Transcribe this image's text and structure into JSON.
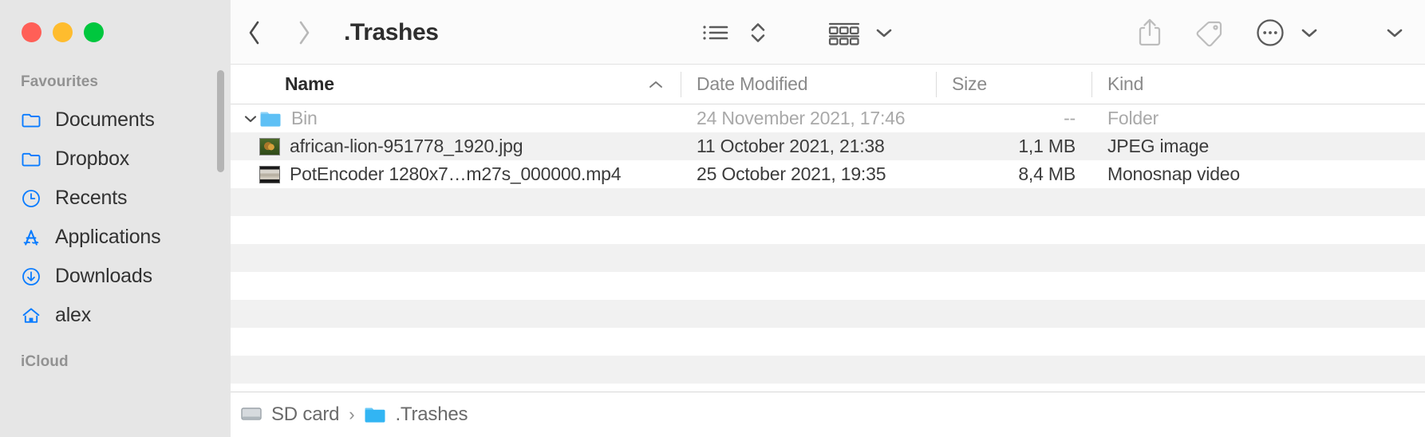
{
  "window": {
    "title": ".Trashes",
    "traffic_lights": [
      {
        "name": "close",
        "color": "#ff5f57"
      },
      {
        "name": "minimize",
        "color": "#febc2e"
      },
      {
        "name": "maximize",
        "color": "#00c73e"
      }
    ]
  },
  "sidebar": {
    "sections": [
      {
        "label": "Favourites"
      },
      {
        "label": "iCloud"
      }
    ],
    "items": [
      {
        "label": "Documents",
        "icon": "folder-icon"
      },
      {
        "label": "Dropbox",
        "icon": "folder-icon"
      },
      {
        "label": "Recents",
        "icon": "clock-icon"
      },
      {
        "label": "Applications",
        "icon": "applications-icon"
      },
      {
        "label": "Downloads",
        "icon": "download-circle-icon"
      },
      {
        "label": "alex",
        "icon": "home-icon"
      }
    ],
    "accent_color": "#0a7cff"
  },
  "toolbar": {
    "back": "back-chevron",
    "forward": "forward-chevron",
    "buttons": [
      {
        "name": "view-as-list",
        "icon": "list-view-icon"
      },
      {
        "name": "view-stepper",
        "icon": "up-down-chevron-icon"
      },
      {
        "name": "group-by",
        "icon": "group-items-icon"
      },
      {
        "name": "group-by-menu",
        "icon": "chevron-down-icon"
      },
      {
        "name": "share",
        "icon": "share-icon"
      },
      {
        "name": "tags",
        "icon": "tag-icon"
      },
      {
        "name": "more-actions",
        "icon": "ellipsis-circle-icon"
      },
      {
        "name": "more-menu",
        "icon": "chevron-down-icon"
      },
      {
        "name": "overflow-menu",
        "icon": "chevron-down-icon"
      },
      {
        "name": "search",
        "icon": "search-icon"
      }
    ]
  },
  "columns": [
    {
      "key": "name",
      "label": "Name",
      "sorted": true,
      "sort_direction": "ascending"
    },
    {
      "key": "date",
      "label": "Date Modified",
      "sorted": false
    },
    {
      "key": "size",
      "label": "Size",
      "sorted": false
    },
    {
      "key": "kind",
      "label": "Kind",
      "sorted": false
    }
  ],
  "files": [
    {
      "name": "Bin",
      "date": "24 November 2021, 17:46",
      "size": "--",
      "kind": "Folder",
      "icon": "blue-folder-icon",
      "expanded": true,
      "dimmed": true,
      "indent": 0
    },
    {
      "name": "african-lion-951778_1920.jpg",
      "date": "11 October 2021, 21:38",
      "size": "1,1 MB",
      "kind": "JPEG image",
      "icon": "image-thumbnail",
      "dimmed": false,
      "indent": 1
    },
    {
      "name": "PotEncoder 1280x7…m27s_000000.mp4",
      "date": "25 October 2021, 19:35",
      "size": "8,4 MB",
      "kind": "Monosnap video",
      "icon": "video-thumbnail",
      "dimmed": false,
      "indent": 1
    }
  ],
  "pathbar": {
    "crumbs": [
      {
        "label": "SD card",
        "icon": "sd-card-drive-icon"
      },
      {
        "label": ".Trashes",
        "icon": "blue-folder-icon"
      }
    ],
    "separator": "›"
  }
}
